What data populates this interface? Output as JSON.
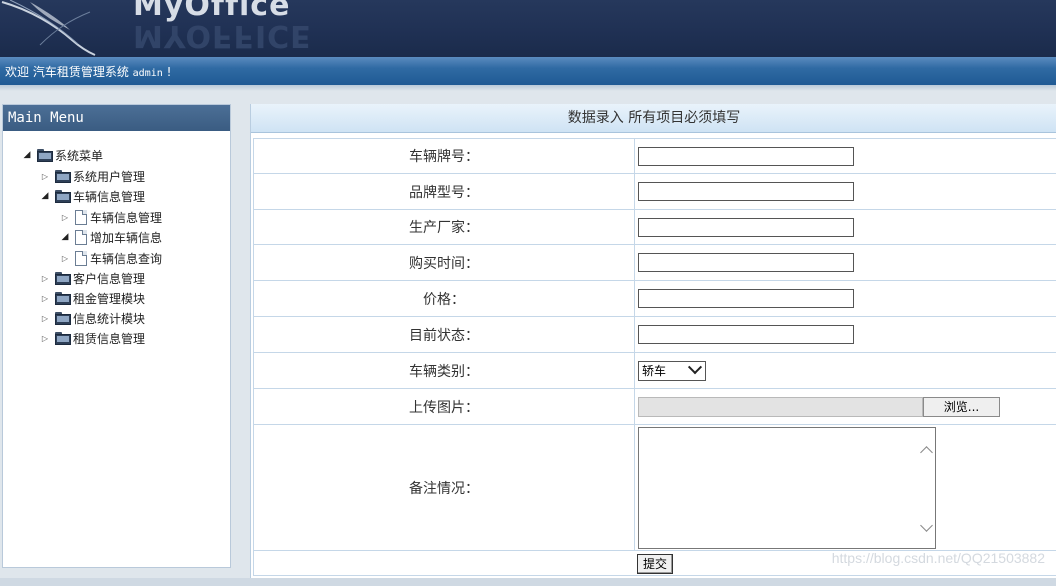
{
  "header": {
    "logo_text": "MyOffice",
    "logo_reflection": "MYOFFICE"
  },
  "welcome": {
    "greeting": "欢迎 汽车租赁管理系统",
    "user": "admin",
    "suffix": "!"
  },
  "sidebar": {
    "title": "Main Menu",
    "root": "系统菜单",
    "items": [
      {
        "label": "系统用户管理"
      },
      {
        "label": "车辆信息管理",
        "children": [
          {
            "label": "车辆信息管理"
          },
          {
            "label": "增加车辆信息"
          },
          {
            "label": "车辆信息查询"
          }
        ]
      },
      {
        "label": "客户信息管理"
      },
      {
        "label": "租金管理模块"
      },
      {
        "label": "信息统计模块"
      },
      {
        "label": "租赁信息管理"
      }
    ]
  },
  "form": {
    "title": "数据录入  所有项目必须填写",
    "fields": [
      {
        "label": "车辆牌号：",
        "value": ""
      },
      {
        "label": "品牌型号：",
        "value": ""
      },
      {
        "label": "生产厂家：",
        "value": ""
      },
      {
        "label": "购买时间：",
        "value": ""
      },
      {
        "label": "价格：",
        "value": ""
      },
      {
        "label": "目前状态：",
        "value": ""
      }
    ],
    "category": {
      "label": "车辆类别：",
      "selected": "轿车"
    },
    "upload": {
      "label": "上传图片：",
      "browse_label": "浏览..."
    },
    "remarks": {
      "label": "备注情况：",
      "value": ""
    },
    "submit_label": "提交"
  },
  "watermark": "https://blog.csdn.net/QQ21503882",
  "colors": {
    "header": "#1f3053",
    "welcome_bar": "#2f6aa3",
    "sidebar_head": "#3a5c82",
    "content_head": "#cfe3f4"
  }
}
